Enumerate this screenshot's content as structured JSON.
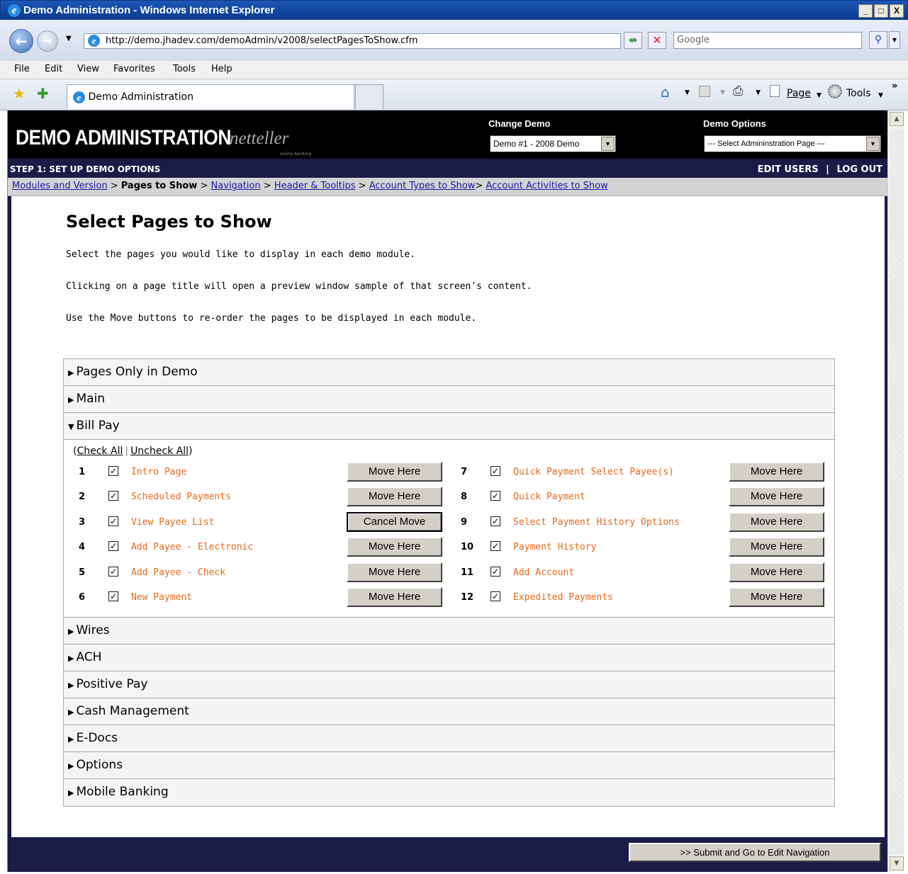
{
  "window": {
    "title": "Demo Administration - Windows Internet Explorer",
    "min": "_",
    "max": "□",
    "close": "X"
  },
  "address": {
    "url": "http://demo.jhadev.com/demoAdmin/v2008/selectPagesToShow.cfm",
    "search_placeholder": "Google"
  },
  "menu": {
    "file": "File",
    "edit": "Edit",
    "view": "View",
    "favorites": "Favorites",
    "tools": "Tools",
    "help": "Help"
  },
  "favbar": {
    "tab_label": "Demo Administration",
    "page": "Page",
    "tools": "Tools"
  },
  "header": {
    "logo": "DEMO ADMINISTRATION",
    "brand": "netteller",
    "brand_sub": "online banking",
    "change_demo_label": "Change Demo",
    "change_demo_value": "Demo #1 - 2008 Demo",
    "demo_options_label": "Demo Options",
    "demo_options_value": "--- Select Admininstration Page ---"
  },
  "stepbar": {
    "step": "STEP 1: SET UP DEMO OPTIONS",
    "edit_users": "EDIT USERS",
    "sep": "|",
    "log_out": "LOG OUT"
  },
  "breadcrumb": [
    {
      "label": "Modules and Version",
      "link": true
    },
    {
      "label": "Pages to Show",
      "link": false
    },
    {
      "label": "Navigation",
      "link": true
    },
    {
      "label": "Header & Tooltips",
      "link": true
    },
    {
      "label": "Account Types to Show",
      "link": true
    },
    {
      "label": "Account Activities to Show",
      "link": true
    }
  ],
  "page": {
    "title": "Select Pages to Show",
    "p1": "Select the pages you would like to display in each demo module.",
    "p2": "Clicking on a page title will open a preview window sample of that screen's content.",
    "p3": "Use the Move buttons to re-order the pages to be displayed in each module."
  },
  "sections_before": [
    "Pages Only in Demo",
    "Main"
  ],
  "expanded": {
    "title": "Bill Pay",
    "check_all": "Check All",
    "uncheck_all": "Uncheck All",
    "pages": [
      {
        "num": "1",
        "label": "Intro Page",
        "button": "Move Here",
        "checked": true
      },
      {
        "num": "2",
        "label": "Scheduled Payments",
        "button": "Move Here",
        "checked": true
      },
      {
        "num": "3",
        "label": "View Payee List",
        "button": "Cancel Move",
        "checked": true
      },
      {
        "num": "4",
        "label": "Add Payee - Electronic",
        "button": "Move Here",
        "checked": true
      },
      {
        "num": "5",
        "label": "Add Payee - Check",
        "button": "Move Here",
        "checked": true
      },
      {
        "num": "6",
        "label": "New Payment",
        "button": "Move Here",
        "checked": true
      },
      {
        "num": "7",
        "label": "Quick Payment Select Payee(s)",
        "button": "Move Here",
        "checked": true
      },
      {
        "num": "8",
        "label": "Quick Payment",
        "button": "Move Here",
        "checked": true
      },
      {
        "num": "9",
        "label": "Select Payment History Options",
        "button": "Move Here",
        "checked": true
      },
      {
        "num": "10",
        "label": "Payment History",
        "button": "Move Here",
        "checked": true
      },
      {
        "num": "11",
        "label": "Add Account",
        "button": "Move Here",
        "checked": true
      },
      {
        "num": "12",
        "label": "Expedited Payments",
        "button": "Move Here",
        "checked": true
      }
    ]
  },
  "sections_after": [
    "Wires",
    "ACH",
    "Positive Pay",
    "Cash Management",
    "E-Docs",
    "Options",
    "Mobile Banking"
  ],
  "footer": {
    "submit": ">> Submit and Go to Edit Navigation"
  },
  "colors": {
    "page_label": "#e8691d",
    "navy": "#1b1b48",
    "link": "#1a1aa8"
  }
}
